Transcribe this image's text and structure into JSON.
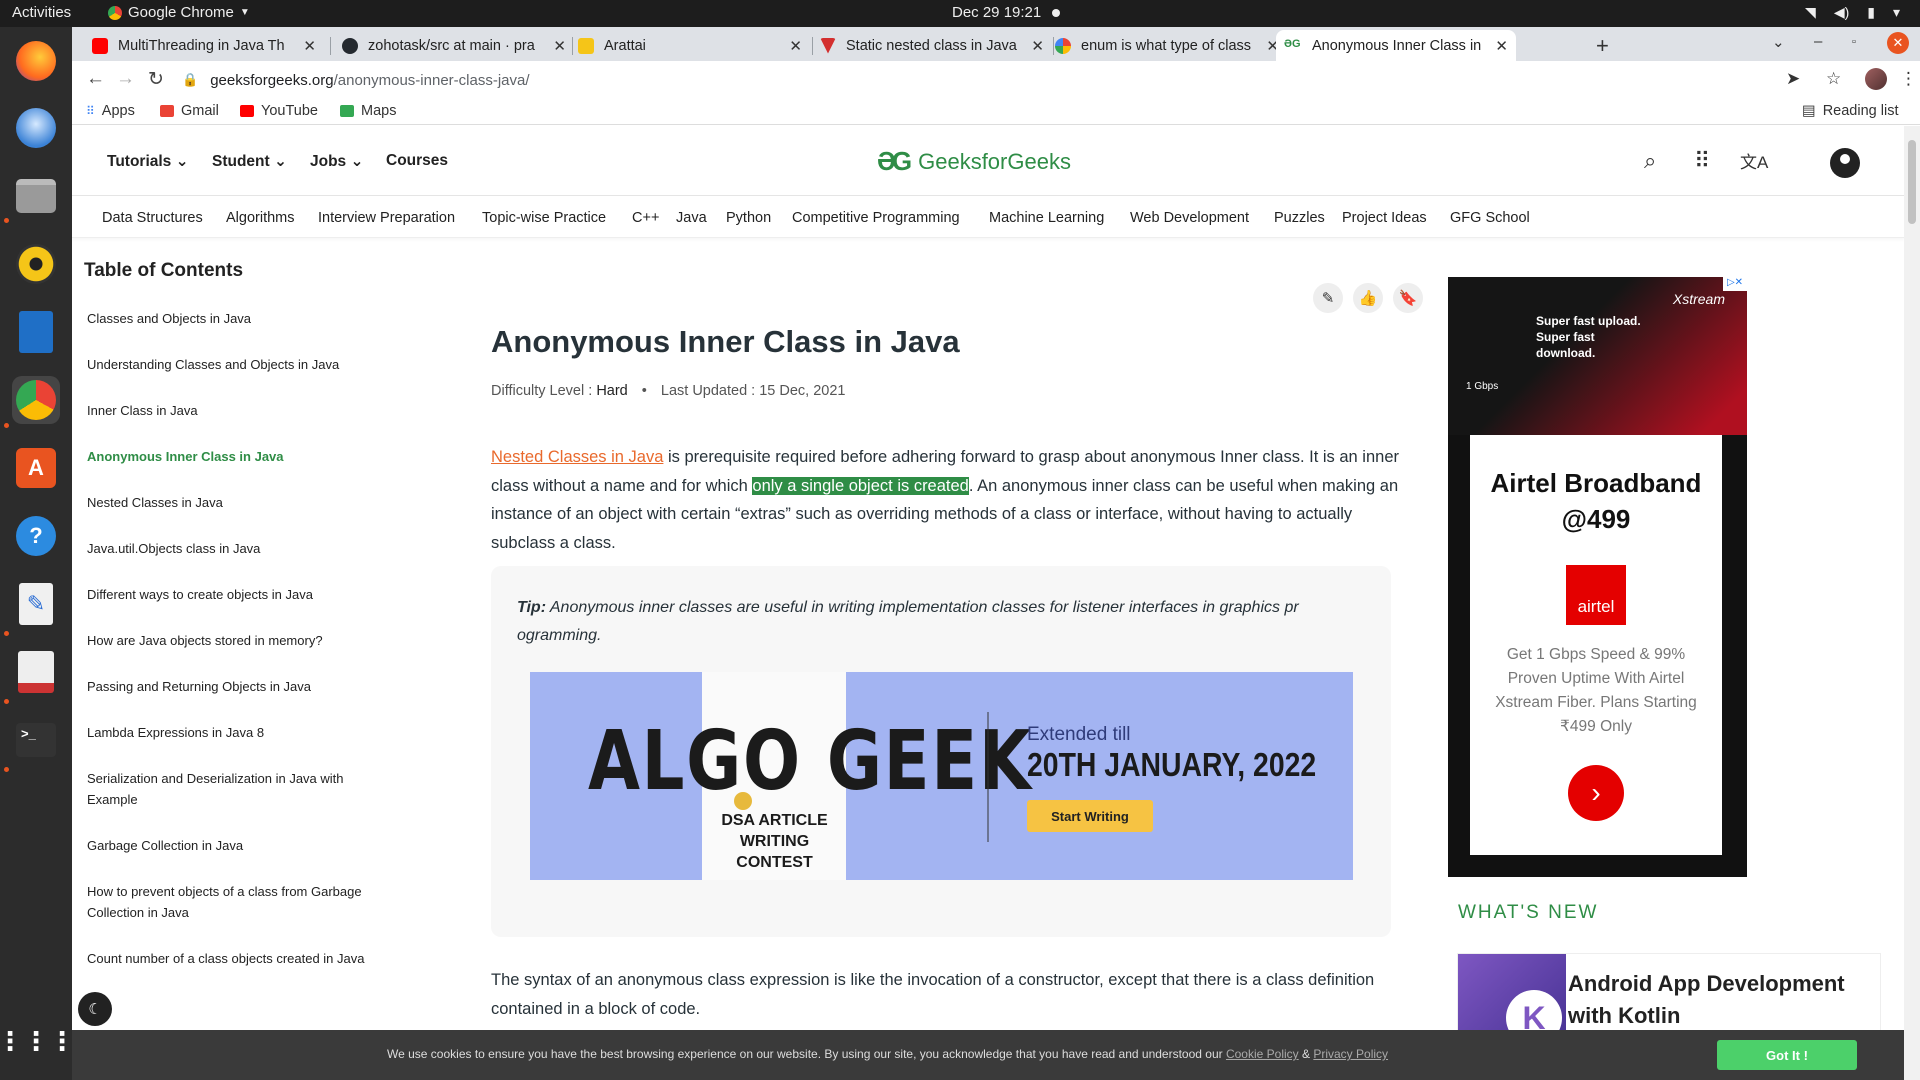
{
  "system": {
    "activities": "Activities",
    "app_menu": "Google Chrome",
    "clock": "Dec 29  19:21"
  },
  "dock": {
    "apps": [
      "firefox-icon",
      "thunderbird-icon",
      "files-icon",
      "rhythmbox-icon",
      "writer-icon",
      "chrome-icon",
      "software-icon",
      "help-icon",
      "text-editor-icon",
      "document-viewer-icon",
      "terminal-icon",
      "app-grid-icon"
    ]
  },
  "tabs": [
    {
      "title": "MultiThreading in Java Th",
      "favicon_color": "#ff0000"
    },
    {
      "title": "zohotask/src at main · pra",
      "favicon_color": "#24292f"
    },
    {
      "title": "Arattai",
      "favicon_color": "#f5c518"
    },
    {
      "title": "Static nested class in Java",
      "favicon_color": "#d32f2f"
    },
    {
      "title": "enum is what type of class",
      "favicon_color": "#4285f4"
    },
    {
      "title": "Anonymous Inner Class in",
      "favicon_color": "#2f8d46"
    }
  ],
  "address_bar": {
    "domain": "geeksforgeeks.org",
    "path": "/anonymous-inner-class-java/"
  },
  "bookmarks": [
    {
      "label": "Apps",
      "color": "#4285f4"
    },
    {
      "label": "Gmail",
      "color": "#ea4335"
    },
    {
      "label": "YouTube",
      "color": "#ff0000"
    },
    {
      "label": "Maps",
      "color": "#34a853"
    }
  ],
  "reading_list": "Reading list",
  "site": {
    "logo_text": "GeeksforGeeks",
    "logo_mark": "ƏG",
    "menu": [
      "Tutorials",
      "Student",
      "Jobs",
      "Courses"
    ],
    "subnav": [
      "Data Structures",
      "Algorithms",
      "Interview Preparation",
      "Topic-wise Practice",
      "C++",
      "Java",
      "Python",
      "Competitive Programming",
      "Machine Learning",
      "Web Development",
      "Puzzles",
      "Project Ideas",
      "GFG School"
    ],
    "brand_color": "#2f8d46"
  },
  "toc": {
    "title": "Table of Contents",
    "items": [
      "Classes and Objects in Java",
      "Understanding Classes and Objects in Java",
      "Inner Class in Java",
      "Anonymous Inner Class in Java",
      "Nested Classes in Java",
      "Java.util.Objects class in Java",
      "Different ways to create objects in Java",
      "How are Java objects stored in memory?",
      "Passing and Returning Objects in Java",
      "Lambda Expressions in Java 8",
      "Serialization and Deserialization in Java with Example",
      "Garbage Collection in Java",
      "How to prevent objects of a class from Garbage Collection in Java",
      "Count number of a class objects created in Java"
    ],
    "current_index": 3
  },
  "article": {
    "title": "Anonymous Inner Class in Java",
    "difficulty_label": "Difficulty Level : ",
    "difficulty": "Hard",
    "updated": "Last Updated : 15 Dec, 2021",
    "p1_link": "Nested Classes in Java",
    "p1_a": " is prerequisite required before adhering forward to grasp about anonymous Inner class. It is an inner class without a name and for which ",
    "p1_highlight": "only a single object is created",
    "p1_b": ". An anonymous inner class can be useful when making an instance of an object with certain “extras” such as overriding methods of a class or interface, without having to actually subclass a class.",
    "tip_label": "Tip:",
    "tip_text": " Anonymous inner classes are useful in writing implementation classes for listener interfaces in graphics pr ogramming.",
    "p2": "The syntax of an anonymous class expression is like the invocation of a constructor, except that there is a class definition contained in a block of code."
  },
  "banner": {
    "headline": "ALGO GEEK",
    "sub": "DSA ARTICLE WRITING CONTEST",
    "extended": "Extended till",
    "date": "20TH JANUARY, 2022",
    "cta": "Start Writing"
  },
  "ad": {
    "brand": "Xstream",
    "slogan": "Super fast upload. Super fast download.",
    "speed": "1 Gbps",
    "headline": "Airtel Broadband @499",
    "logo": "airtel",
    "desc": "Get 1 Gbps Speed & 99% Proven Uptime With Airtel Xstream Fiber. Plans Starting ₹499 Only"
  },
  "whats_new": {
    "title": "WHAT'S NEW",
    "card": "Android App Development with Kotlin"
  },
  "cookie": {
    "text": "We use cookies to ensure you have the best browsing experience on our website. By using our site, you acknowledge that you have read and understood our ",
    "policy": "Cookie Policy",
    "amp": " & ",
    "privacy": "Privacy Policy",
    "button": "Got It !"
  }
}
